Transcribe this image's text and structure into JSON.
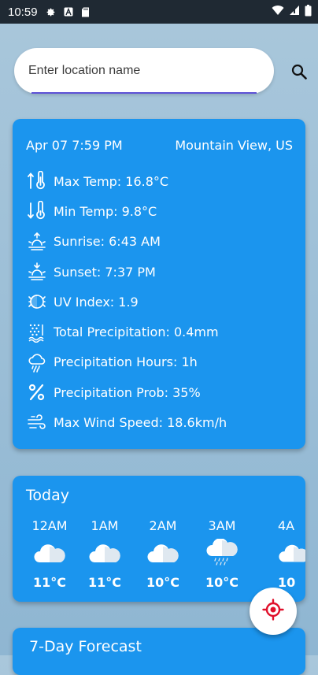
{
  "status_bar": {
    "time": "10:59",
    "icons": [
      "gear-icon",
      "a-badge-icon",
      "sd-card-icon",
      "wifi-icon",
      "signal-icon",
      "battery-icon"
    ]
  },
  "search": {
    "placeholder": "Enter location name"
  },
  "details": {
    "date_time": "Apr 07 7:59 PM",
    "location": "Mountain View, US",
    "rows": [
      {
        "label": "Max Temp: 16.8°C",
        "icon": "thermometer-up-icon"
      },
      {
        "label": "Min Temp: 9.8°C",
        "icon": "thermometer-down-icon"
      },
      {
        "label": "Sunrise: 6:43 AM",
        "icon": "sunrise-icon"
      },
      {
        "label": "Sunset: 7:37 PM",
        "icon": "sunset-icon"
      },
      {
        "label": "UV Index: 1.9",
        "icon": "uv-index-icon"
      },
      {
        "label": "Total Precipitation: 0.4mm",
        "icon": "precipitation-icon"
      },
      {
        "label": "Precipitation Hours: 1h",
        "icon": "rain-cloud-icon"
      },
      {
        "label": "Precipitation Prob: 35%",
        "icon": "percent-icon"
      },
      {
        "label": "Max Wind Speed: 18.6km/h",
        "icon": "wind-icon"
      }
    ]
  },
  "today": {
    "title": "Today",
    "hours": [
      {
        "hour": "12AM",
        "temp": "11°C",
        "icon": "cloud-icon"
      },
      {
        "hour": "1AM",
        "temp": "11°C",
        "icon": "cloud-icon"
      },
      {
        "hour": "2AM",
        "temp": "10°C",
        "icon": "cloud-icon"
      },
      {
        "hour": "3AM",
        "temp": "10°C",
        "icon": "drizzle-cloud-icon"
      },
      {
        "hour": "4A",
        "temp": "10",
        "icon": "cloud-icon"
      }
    ]
  },
  "forecast": {
    "title": "7-Day Forecast"
  },
  "colors": {
    "card": "#1b95ee",
    "background": "#9fc0d8",
    "status_bar": "#1f2933",
    "fab_icon": "#e0102b"
  }
}
